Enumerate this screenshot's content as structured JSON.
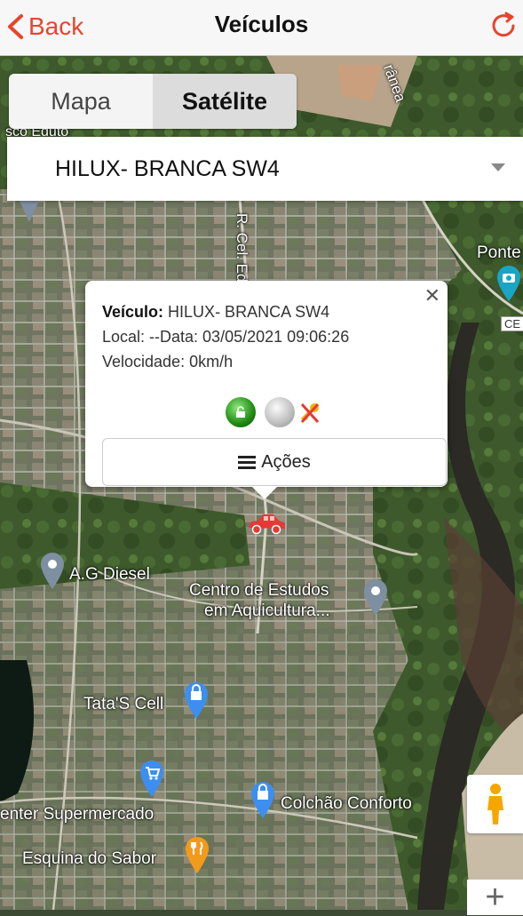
{
  "nav": {
    "back_label": "Back",
    "title": "Veículos"
  },
  "segmented": {
    "map_label": "Mapa",
    "satellite_label": "Satélite",
    "selected": "Satélite"
  },
  "vehicle_select": {
    "value": "HILUX- BRANCA SW4"
  },
  "popup": {
    "vehicle_label": "Veículo:",
    "vehicle_value": "HILUX- BRANCA SW4",
    "local_text": "Local: --Data: 03/05/2021 09:06:26",
    "speed_text": "Velocidade: 0km/h",
    "actions_label": "Ações"
  },
  "map_labels": {
    "diesel": "A.G Diesel",
    "centro_line1": "Centro de Estudos",
    "centro_line2": "em Aquicultura...",
    "tatas": "Tata'S Cell",
    "supermercado": "enter Supermercado",
    "colchao": "Colchão Conforto",
    "esquina": "Esquina do Sabor",
    "ponte": "Ponte",
    "street_edu": "R. Cel. Ed",
    "street_ranea": "rânea",
    "road_ce": "CE",
    "street_edu_top": "sco Eduto"
  },
  "colors": {
    "accent": "#e8442e",
    "pin_blue": "#3d8ef0",
    "pin_gray": "#7d8fa0",
    "pin_orange": "#f29a1b",
    "car_red": "#e53935",
    "pin_teal": "#1aa5c4"
  }
}
